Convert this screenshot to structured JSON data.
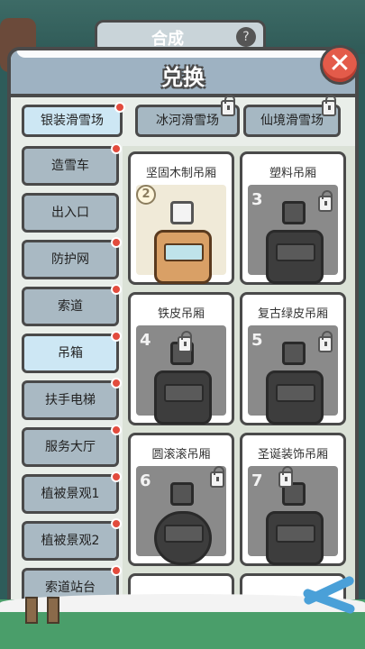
{
  "background": {
    "chip_label": "合成",
    "help_icon": "question-icon"
  },
  "title": "兑换",
  "close_label": "✕",
  "tabs": [
    {
      "label": "银装滑雪场",
      "active": true,
      "badge": true,
      "locked": false
    },
    {
      "label": "冰河滑雪场",
      "active": false,
      "badge": false,
      "locked": true
    },
    {
      "label": "仙境滑雪场",
      "active": false,
      "badge": false,
      "locked": true
    }
  ],
  "sidebar": [
    {
      "label": "造雪车",
      "badge": true
    },
    {
      "label": "出入口",
      "badge": false
    },
    {
      "label": "防护网",
      "badge": true
    },
    {
      "label": "索道",
      "badge": true
    },
    {
      "label": "吊箱",
      "badge": true,
      "active": true
    },
    {
      "label": "扶手电梯",
      "badge": true
    },
    {
      "label": "服务大厅",
      "badge": true
    },
    {
      "label": "植被景观1",
      "badge": true
    },
    {
      "label": "植被景观2",
      "badge": true
    },
    {
      "label": "索道站台",
      "badge": true
    }
  ],
  "cards": [
    {
      "title": "坚固木制吊厢",
      "num": "2",
      "badge": true,
      "locked": false
    },
    {
      "title": "塑料吊厢",
      "num": "3",
      "badge": false,
      "locked": true
    },
    {
      "title": "铁皮吊厢",
      "num": "4",
      "badge": false,
      "locked": true
    },
    {
      "title": "复古绿皮吊厢",
      "num": "5",
      "badge": false,
      "locked": true
    },
    {
      "title": "圆滚滚吊厢",
      "num": "6",
      "badge": false,
      "locked": true
    },
    {
      "title": "圣诞装饰吊厢",
      "num": "7",
      "badge": false,
      "locked": true
    }
  ]
}
